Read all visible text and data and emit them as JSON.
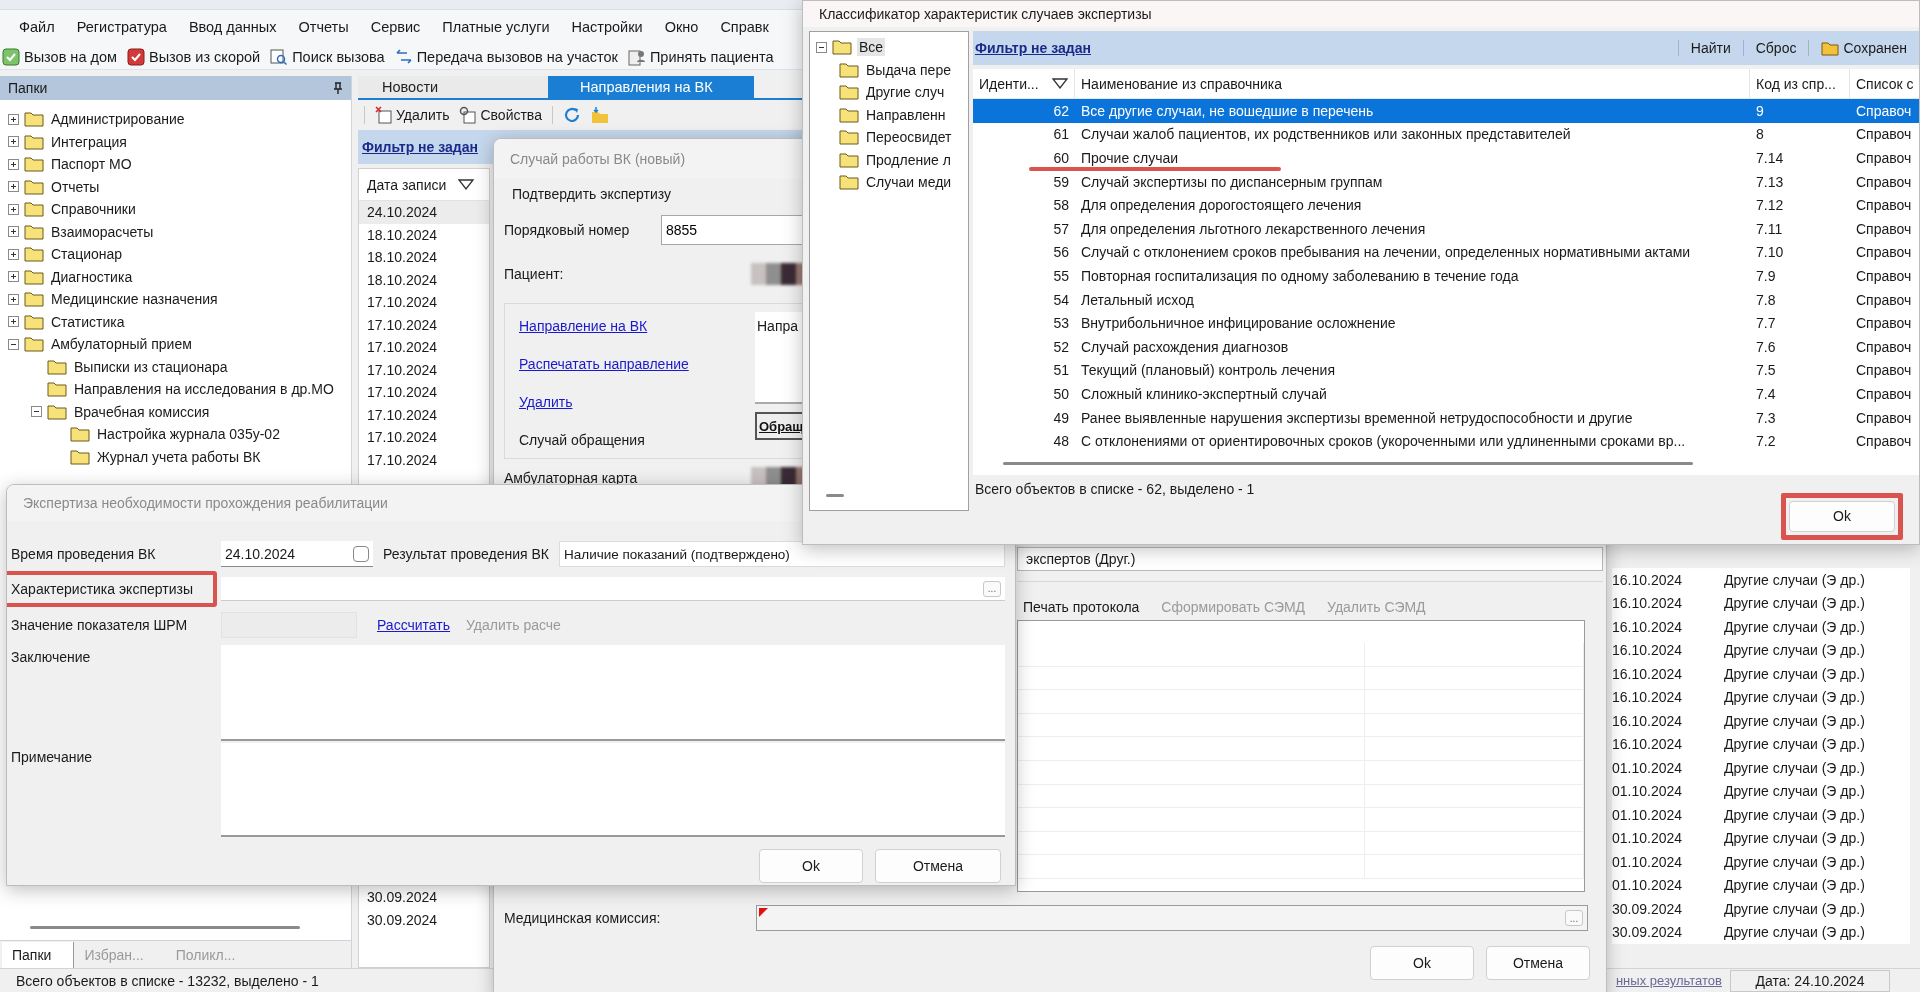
{
  "menu": [
    "Файл",
    "Регистратура",
    "Ввод данных",
    "Отчеты",
    "Сервис",
    "Платные услуги",
    "Настройки",
    "Окно",
    "Справк"
  ],
  "quick_toolbar": [
    "Вызов на дом",
    "Вызов из скорой",
    "Поиск вызова",
    "Передача вызовов на участок",
    "Принять пациента"
  ],
  "folders_panel": {
    "title": "Папки",
    "tree": [
      {
        "label": "Администрирование",
        "expanded": false
      },
      {
        "label": "Интеграция",
        "expanded": false
      },
      {
        "label": "Паспорт МО",
        "expanded": false
      },
      {
        "label": "Отчеты",
        "expanded": false
      },
      {
        "label": "Справочники",
        "expanded": false
      },
      {
        "label": "Взаиморасчеты",
        "expanded": false
      },
      {
        "label": "Стационар",
        "expanded": false
      },
      {
        "label": "Диагностика",
        "expanded": false
      },
      {
        "label": "Медицинские назначения",
        "expanded": false
      },
      {
        "label": "Статистика",
        "expanded": false
      },
      {
        "label": "Амбулаторный прием",
        "expanded": true,
        "children": [
          {
            "label": "Выписки из стационара"
          },
          {
            "label": "Направления на исследования в др.МО"
          },
          {
            "label": "Врачебная комиссия",
            "expanded": true,
            "children": [
              {
                "label": "Настройка журнала 035у-02"
              },
              {
                "label": "Журнал учета работы ВК"
              }
            ]
          }
        ]
      }
    ],
    "tabs": [
      {
        "label": "Папки",
        "selected": true
      },
      {
        "label": "Избран...",
        "selected": false
      },
      {
        "label": "Поликл...",
        "selected": false
      }
    ]
  },
  "tabs": [
    {
      "label": "Новости",
      "selected": false
    },
    {
      "label": "Направления на ВК",
      "selected": true
    }
  ],
  "list_toolbar": [
    "Удалить",
    "Свойства"
  ],
  "filter_link": "Фильтр не задан",
  "date_column": "Дата записи",
  "records_top": [
    {
      "date": "24.10.2024",
      "selected": true
    },
    {
      "date": "18.10.2024",
      "selected": false
    },
    {
      "date": "18.10.2024",
      "selected": false
    },
    {
      "date": "18.10.2024",
      "selected": false
    },
    {
      "date": "17.10.2024",
      "selected": false
    },
    {
      "date": "17.10.2024",
      "selected": false
    },
    {
      "date": "17.10.2024",
      "selected": false
    },
    {
      "date": "17.10.2024",
      "selected": false
    },
    {
      "date": "17.10.2024",
      "selected": false
    },
    {
      "date": "17.10.2024",
      "selected": false
    },
    {
      "date": "17.10.2024",
      "selected": false
    },
    {
      "date": "17.10.2024",
      "selected": false
    }
  ],
  "records_bottom": [
    {
      "date": "30.09.2024",
      "selected": false
    },
    {
      "date": "30.09.2024",
      "selected": false
    }
  ],
  "side_records": [
    {
      "date": "16.10.2024",
      "category": "Другие случаи (Э др.)"
    },
    {
      "date": "16.10.2024",
      "category": "Другие случаи (Э др.)"
    },
    {
      "date": "16.10.2024",
      "category": "Другие случаи (Э др.)"
    },
    {
      "date": "16.10.2024",
      "category": "Другие случаи (Э др.)"
    },
    {
      "date": "16.10.2024",
      "category": "Другие случаи (Э др.)"
    },
    {
      "date": "16.10.2024",
      "category": "Другие случаи (Э др.)"
    },
    {
      "date": "16.10.2024",
      "category": "Другие случаи (Э др.)"
    },
    {
      "date": "16.10.2024",
      "category": "Другие случаи (Э др.)"
    },
    {
      "date": "01.10.2024",
      "category": "Другие случаи (Э др.)"
    },
    {
      "date": "01.10.2024",
      "category": "Другие случаи (Э др.)"
    },
    {
      "date": "01.10.2024",
      "category": "Другие случаи (Э др.)"
    },
    {
      "date": "01.10.2024",
      "category": "Другие случаи (Э др.)"
    },
    {
      "date": "01.10.2024",
      "category": "Другие случаи (Э др.)"
    },
    {
      "date": "01.10.2024",
      "category": "Другие случаи (Э др.)"
    },
    {
      "date": "30.09.2024",
      "category": "Другие случаи (Э др.)"
    },
    {
      "date": "30.09.2024",
      "category": "Другие случаи (Э др.)"
    }
  ],
  "status_bar": {
    "text": "Всего объектов в списке - 13232, выделено - 1",
    "link": "нных результатов",
    "date": "Дата: 24.10.2024"
  },
  "case_window": {
    "title": "Случай работы ВК (новый)",
    "confirm_button": "Подтвердить экспертизу",
    "number_label": "Порядковый номер",
    "number_value": "8855",
    "patient_label": "Пациент:",
    "links": [
      "Направление на ВК",
      "Распечатать направление",
      "Удалить"
    ],
    "appeal_label": "Случай обращения",
    "appeal_button": "Обращ",
    "note_text": "Напра",
    "card_label": "Амбулаторная карта",
    "experts_value": "экспертов (Друг.)",
    "grid_toolbar": [
      {
        "label": "Печать протокола",
        "disabled": false
      },
      {
        "label": "Сформировать СЭМД",
        "disabled": true
      },
      {
        "label": "Удалить СЭМД",
        "disabled": true
      }
    ],
    "commission_label": "Медицинская комиссия:",
    "commission_required": true,
    "browse_button": "...",
    "buttons": [
      "Ok",
      "Отмена"
    ]
  },
  "expertise_window": {
    "title": "Экспертиза необходимости прохождения реабилитации",
    "time_label": "Время проведения ВК",
    "time_value": "24.10.2024",
    "time_checked": false,
    "result_label": "Результат проведения ВК",
    "result_value": "Наличие показаний (подтверждено)",
    "characteristic": {
      "label": "Характеристика экспертизы",
      "highlighted": true,
      "browse_button": "..."
    },
    "shrm_label": "Значение показателя ШРМ",
    "calc_link": "Рассчитать",
    "delete_calc": {
      "label": "Удалить расче",
      "disabled": true
    },
    "conclusion_label": "Заключение",
    "note_label": "Примечание",
    "buttons": [
      "Ok",
      "Отмена"
    ]
  },
  "classifier_window": {
    "title": "Классификатор характеристик случаев экспертизы",
    "tree": {
      "label": "Все",
      "expanded": true,
      "selected": true,
      "children": [
        {
          "label": "Выдача пере",
          "selected": false
        },
        {
          "label": "Другие случ",
          "selected": false
        },
        {
          "label": "Направленн",
          "selected": false
        },
        {
          "label": "Переосвидет",
          "selected": false
        },
        {
          "label": "Продление л",
          "selected": false
        },
        {
          "label": "Случаи меди",
          "selected": false
        }
      ]
    },
    "filter_link": "Фильтр не задан",
    "filter_actions": [
      "Найти",
      "Сброс",
      "Сохранен"
    ],
    "columns": [
      "Иденти...",
      "Наименование из справочника",
      "Код из спр...",
      "Список с"
    ],
    "rows": [
      {
        "id": "62",
        "name": "Все другие случаи, не вошедшие в перечень",
        "code": "9",
        "list": "Справоч",
        "selected": true,
        "underlined": false
      },
      {
        "id": "61",
        "name": "Случаи жалоб пациентов, их родственников или законных представителей",
        "code": "8",
        "list": "Справоч",
        "selected": false,
        "underlined": false
      },
      {
        "id": "60",
        "name": "Прочие случаи",
        "code": "7.14",
        "list": "Справоч",
        "selected": false,
        "underlined": true
      },
      {
        "id": "59",
        "name": "Случай экспертизы по диспансерным группам",
        "code": "7.13",
        "list": "Справоч",
        "selected": false,
        "underlined": false
      },
      {
        "id": "58",
        "name": "Для определения дорогостоящего лечения",
        "code": "7.12",
        "list": "Справоч",
        "selected": false,
        "underlined": false
      },
      {
        "id": "57",
        "name": "Для определения льготного лекарственного лечения",
        "code": "7.11",
        "list": "Справоч",
        "selected": false,
        "underlined": false
      },
      {
        "id": "56",
        "name": "Случай с отклонением сроков пребывания на лечении, определенных нормативными актами",
        "code": "7.10",
        "list": "Справоч",
        "selected": false,
        "underlined": false
      },
      {
        "id": "55",
        "name": "Повторная госпитализация по одному заболеванию в течение года",
        "code": "7.9",
        "list": "Справоч",
        "selected": false,
        "underlined": false
      },
      {
        "id": "54",
        "name": "Летальный исход",
        "code": "7.8",
        "list": "Справоч",
        "selected": false,
        "underlined": false
      },
      {
        "id": "53",
        "name": "Внутрибольничное инфицирование осложнение",
        "code": "7.7",
        "list": "Справоч",
        "selected": false,
        "underlined": false
      },
      {
        "id": "52",
        "name": "Случай расхождения диагнозов",
        "code": "7.6",
        "list": "Справоч",
        "selected": false,
        "underlined": false
      },
      {
        "id": "51",
        "name": "Текущий (плановый) контроль лечения",
        "code": "7.5",
        "list": "Справоч",
        "selected": false,
        "underlined": false
      },
      {
        "id": "50",
        "name": "Сложный клинико-экспертный случай",
        "code": "7.4",
        "list": "Справоч",
        "selected": false,
        "underlined": false
      },
      {
        "id": "49",
        "name": "Ранее выявленные нарушения экспертизы временной нетрудоспособности и другие",
        "code": "7.3",
        "list": "Справоч",
        "selected": false,
        "underlined": false
      },
      {
        "id": "48",
        "name": "С отклонениями от ориентировочных сроков (укороченными или удлиненными сроками вр...",
        "code": "7.2",
        "list": "Справоч",
        "selected": false,
        "underlined": false
      }
    ],
    "status": "Всего объектов в списке - 62, выделено - 1",
    "ok_button": {
      "label": "Ok",
      "highlighted": true
    }
  }
}
